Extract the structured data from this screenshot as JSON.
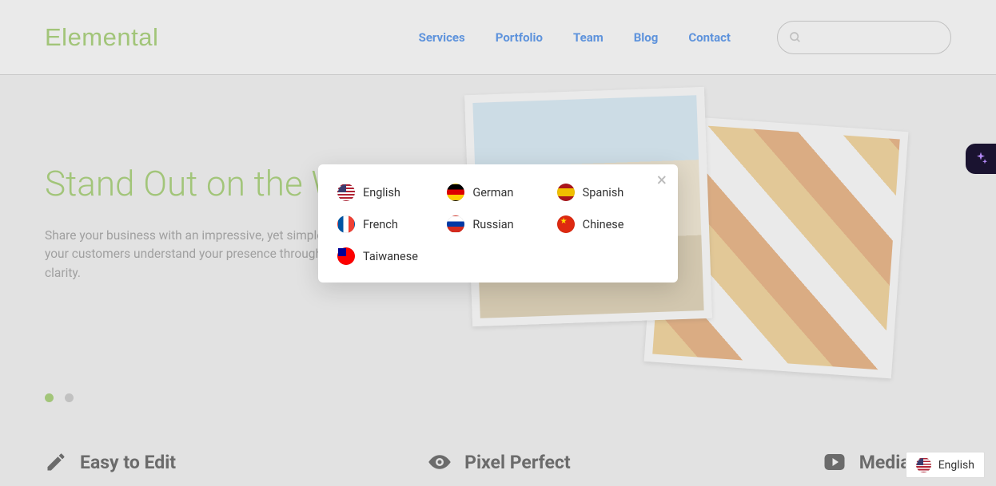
{
  "brand": "Elemental",
  "nav": {
    "services": "Services",
    "portfolio": "Portfolio",
    "team": "Team",
    "blog": "Blog",
    "contact": "Contact"
  },
  "search": {
    "placeholder": ""
  },
  "hero": {
    "title": "Stand Out on the Web",
    "text": "Share your business with an impressive, yet simple presentation. Let your customers understand your presence through elegance and clarity."
  },
  "features": {
    "edit": "Easy to Edit",
    "pixel": "Pixel Perfect",
    "media": "Media Rich"
  },
  "languages": {
    "english": "English",
    "german": "German",
    "spanish": "Spanish",
    "french": "French",
    "russian": "Russian",
    "chinese": "Chinese",
    "taiwanese": "Taiwanese"
  },
  "lang_switcher": {
    "current": "English"
  }
}
